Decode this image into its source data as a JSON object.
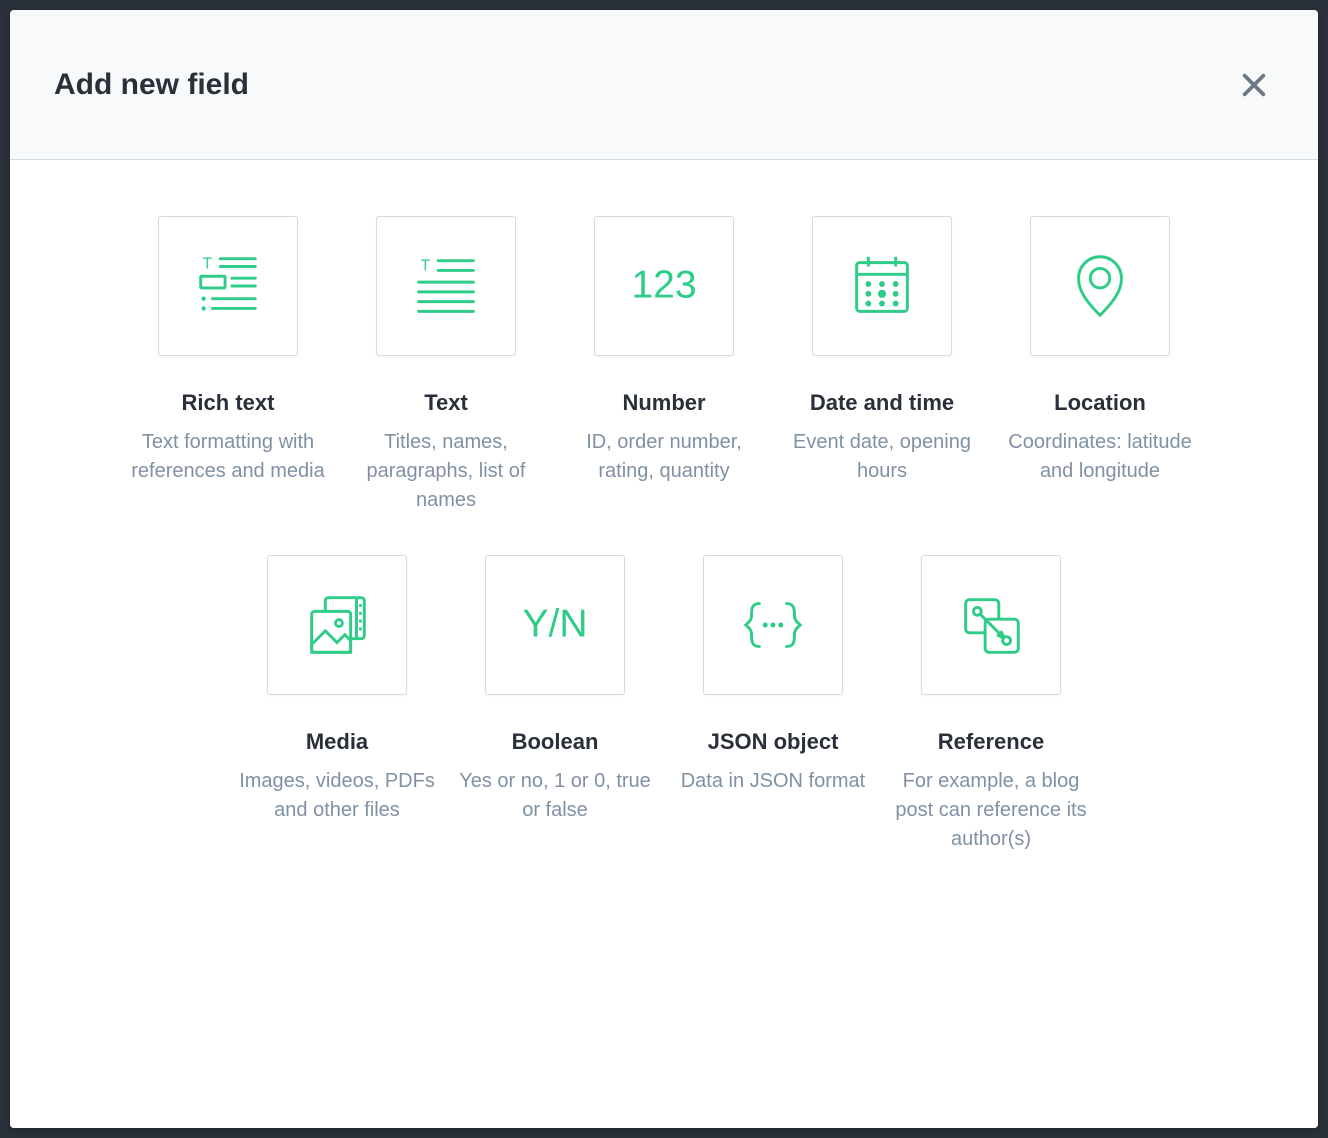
{
  "dialog": {
    "title": "Add new field"
  },
  "field_types": [
    {
      "id": "rich-text",
      "title": "Rich text",
      "desc": "Text formatting with references and media"
    },
    {
      "id": "text",
      "title": "Text",
      "desc": "Titles, names, paragraphs, list of names"
    },
    {
      "id": "number",
      "title": "Number",
      "desc": "ID, order number, rating, quantity"
    },
    {
      "id": "datetime",
      "title": "Date and time",
      "desc": "Event date, opening hours"
    },
    {
      "id": "location",
      "title": "Location",
      "desc": "Coordinates: latitude and longitude"
    },
    {
      "id": "media",
      "title": "Media",
      "desc": "Images, videos, PDFs and other files"
    },
    {
      "id": "boolean",
      "title": "Boolean",
      "desc": "Yes or no, 1 or 0, true or false"
    },
    {
      "id": "json",
      "title": "JSON object",
      "desc": "Data in JSON format"
    },
    {
      "id": "reference",
      "title": "Reference",
      "desc": "For example, a blog post can reference its author(s)"
    }
  ],
  "colors": {
    "accent": "#2ecc87",
    "text_primary": "#2a3039",
    "text_secondary": "#8091a5",
    "border": "#d3dce0",
    "header_bg": "#f7f9fa"
  }
}
